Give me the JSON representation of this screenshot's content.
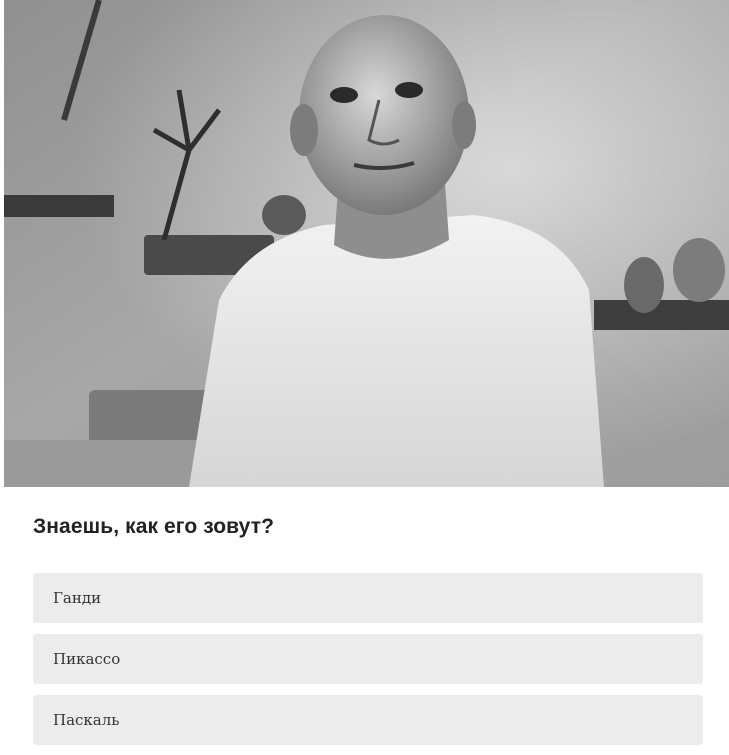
{
  "quiz": {
    "photo_alt": "",
    "question": "Знаешь, как его зовут?",
    "options": [
      {
        "label": "Ганди"
      },
      {
        "label": "Пикассо"
      },
      {
        "label": "Паскаль"
      }
    ]
  },
  "colors": {
    "option_background": "#ececec",
    "question_text": "#222222",
    "page_background": "#ffffff"
  }
}
